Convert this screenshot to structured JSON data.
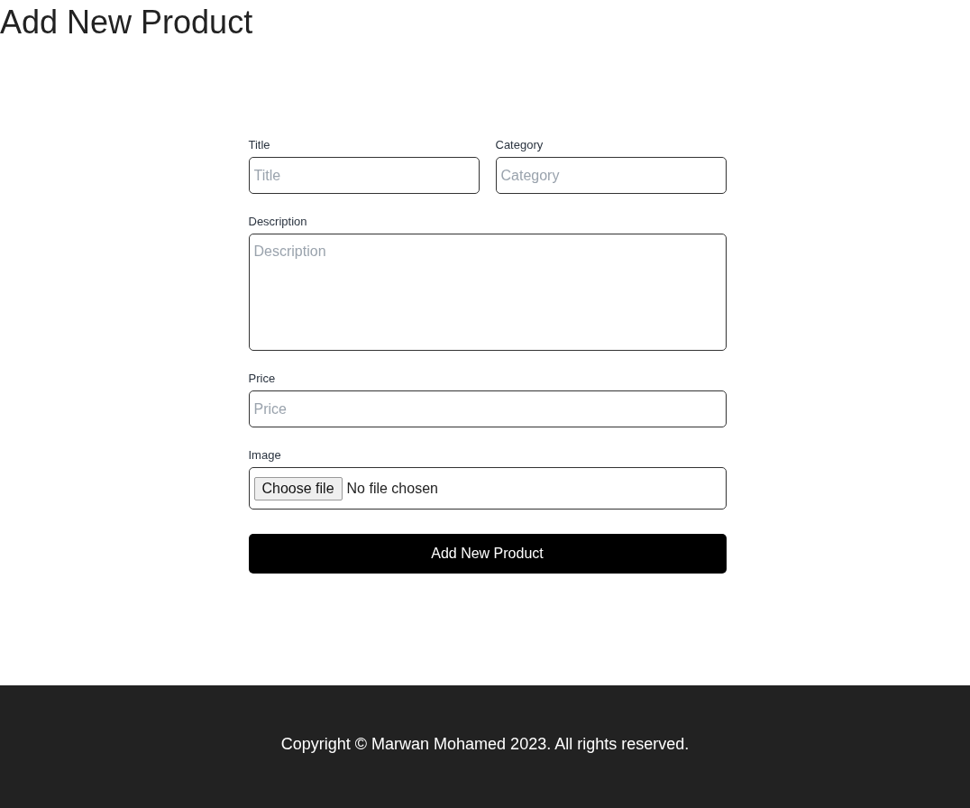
{
  "page_title": "Add New Product",
  "form": {
    "row": [
      {
        "label": "Title",
        "kind": "text",
        "placeholder": "Title"
      },
      {
        "label": "Category",
        "kind": "text",
        "placeholder": "Category"
      }
    ],
    "fields": [
      {
        "label": "Description",
        "kind": "textarea",
        "placeholder": "Description"
      },
      {
        "label": "Price",
        "kind": "text",
        "placeholder": "Price"
      },
      {
        "label": "Image",
        "kind": "file",
        "button": "Choose file",
        "status": "No file chosen"
      }
    ],
    "submit": "Add New Product"
  },
  "footer": {
    "copyright": "Copyright © Marwan Mohamed 2023. All rights reserved."
  }
}
